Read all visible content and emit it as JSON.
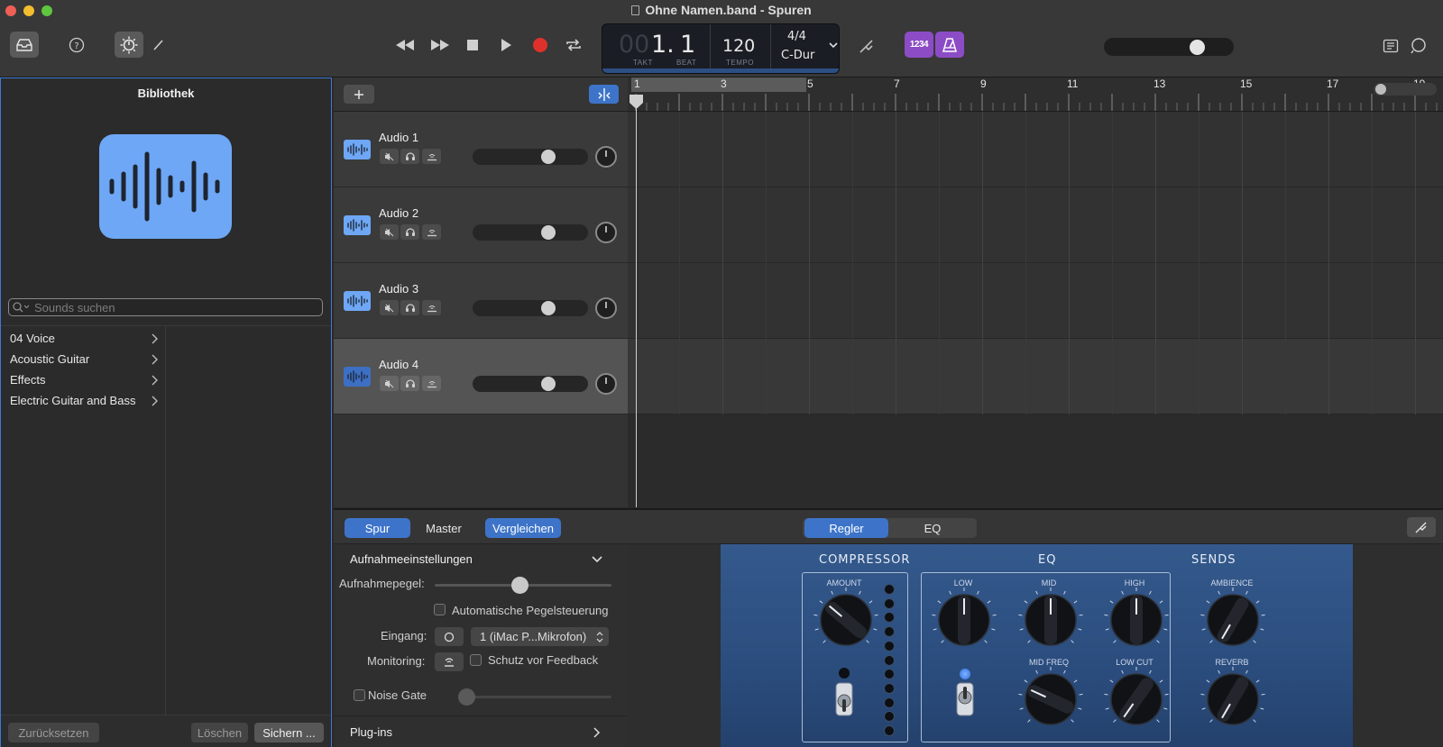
{
  "window": {
    "title": "Ohne Namen.band - Spuren"
  },
  "lcd": {
    "bar_dim": "00",
    "bar": "1.",
    "beat": "1",
    "bar_label": "TAKT",
    "beat_label": "BEAT",
    "tempo": "120",
    "tempo_label": "TEMPO",
    "signature": "4/4",
    "key": "C-Dur"
  },
  "count_in": {
    "label": "1234"
  },
  "master_volume": {
    "fraction": 0.72
  },
  "library": {
    "title": "Bibliothek",
    "search_placeholder": "Sounds suchen",
    "categories": [
      {
        "label": "04 Voice"
      },
      {
        "label": "Acoustic Guitar"
      },
      {
        "label": "Effects"
      },
      {
        "label": "Electric Guitar and Bass"
      }
    ],
    "reset_label": "Zurücksetzen",
    "delete_label": "Löschen",
    "save_label": "Sichern ..."
  },
  "tracks": [
    {
      "name": "Audio 1",
      "volume": 0.72,
      "selected": false
    },
    {
      "name": "Audio 2",
      "volume": 0.72,
      "selected": false
    },
    {
      "name": "Audio 3",
      "volume": 0.72,
      "selected": false
    },
    {
      "name": "Audio 4",
      "volume": 0.72,
      "selected": true
    }
  ],
  "ruler": {
    "bars": [
      "1",
      "3",
      "5",
      "7",
      "9",
      "11",
      "13",
      "15",
      "17",
      "19"
    ]
  },
  "smart_controls": {
    "tabs": [
      {
        "label": "Spur",
        "active": true
      },
      {
        "label": "Master",
        "active": false
      },
      {
        "label": "Vergleichen",
        "active": true
      }
    ],
    "view_tabs": [
      {
        "label": "Regler",
        "active": true
      },
      {
        "label": "EQ",
        "active": false
      }
    ],
    "recording_settings_label": "Aufnahmeeinstellungen",
    "record_level_label": "Aufnahmepegel:",
    "record_level": 0.48,
    "auto_level_label": "Automatische Pegelsteuerung",
    "input_label": "Eingang:",
    "input_value": "1 (iMac P...Mikrofon)",
    "monitoring_label": "Monitoring:",
    "feedback_label": "Schutz vor Feedback",
    "noise_gate_label": "Noise Gate",
    "plugins_label": "Plug-ins"
  },
  "amp": {
    "compressor_title": "COMPRESSOR",
    "eq_title": "EQ",
    "sends_title": "SENDS",
    "amount_label": "AMOUNT",
    "low_label": "LOW",
    "mid_label": "MID",
    "high_label": "HIGH",
    "mid_freq_label": "MID FREQ",
    "low_cut_label": "LOW CUT",
    "ambience_label": "AMBIENCE",
    "reverb_label": "REVERB",
    "colors": {
      "panel": "#2b4d7e",
      "accent": "#3d74c9",
      "record": "#e0302b",
      "purple": "#8c4cc6"
    }
  }
}
